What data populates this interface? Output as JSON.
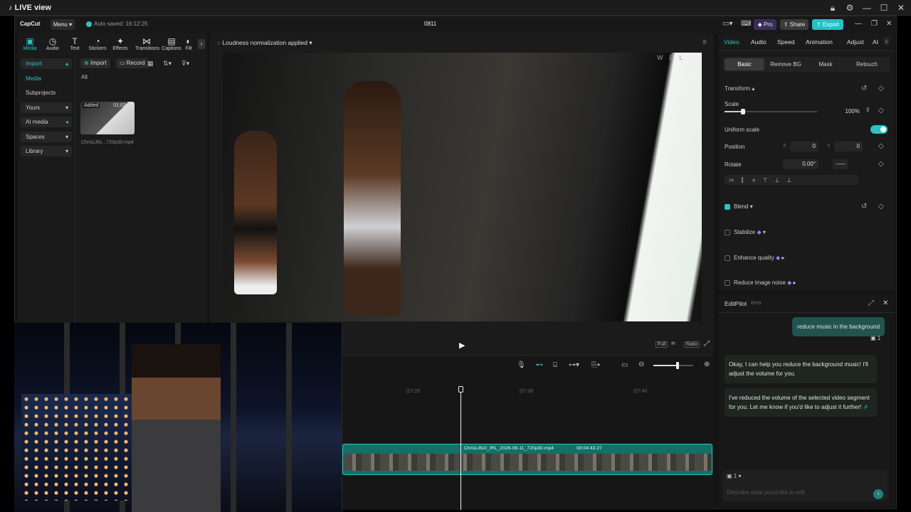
{
  "window": {
    "title": "LIVE view"
  },
  "header": {
    "logo": "CapCut",
    "menu": "Menu",
    "autosave": "Auto saved: 16:12:25",
    "project": "0811",
    "pro": "Pro",
    "share": "Share",
    "export": "Export"
  },
  "toolbar": {
    "tabs": [
      {
        "label": "Media",
        "icon": "▣"
      },
      {
        "label": "Audio",
        "icon": "◷"
      },
      {
        "label": "Text",
        "icon": "T"
      },
      {
        "label": "Stickers",
        "icon": "◔"
      },
      {
        "label": "Effects",
        "icon": "✦"
      },
      {
        "label": "Transitions",
        "icon": "⋈"
      },
      {
        "label": "Captions",
        "icon": "▤"
      },
      {
        "label": "Filt",
        "icon": "◐"
      }
    ]
  },
  "sidebar": {
    "items": [
      "Import",
      "Media",
      "Subprojects",
      "Yours",
      "AI media",
      "Spaces",
      "Library"
    ]
  },
  "media": {
    "import_btn": "Import",
    "record_btn": "Record",
    "filter_all": "All",
    "clip_badge": "Added",
    "clip_duration": "01:02:11",
    "clip_name": "ChrisLifts...720p30.mp4"
  },
  "player": {
    "status": "Loudness normalization applied",
    "full": "Full",
    "ratio": "Ratio",
    "watermark": "W E L"
  },
  "inspector": {
    "tabs": [
      "Video",
      "Audio",
      "Speed",
      "Animation",
      "Adjust",
      "AI"
    ],
    "subtabs": [
      "Basic",
      "Remove BG",
      "Mask",
      "Retouch"
    ],
    "transform": "Transform",
    "scale": "Scale",
    "scale_value": "100%",
    "scale_level": 0.2,
    "uniform_scale": "Uniform scale",
    "position": "Position",
    "pos_x_label": "X",
    "pos_x": "0",
    "pos_y_label": "Y",
    "pos_y": "0",
    "rotate": "Rotate",
    "rotate_value": "0.00°",
    "blend": "Blend",
    "stabilize": "Stabilize",
    "enhance": "Enhance quality",
    "reduce_noise": "Reduce image noise"
  },
  "editpilot": {
    "title": "EditPilot",
    "beta": "Beta",
    "user_msg": "reduce music in the background",
    "clip_count": "1",
    "ai_msg1": "Okay, I can help you reduce the background music! I'll adjust the volume for you.",
    "ai_msg2": "I've reduced the volume of the selected video segment for you. Let me know if you'd like to adjust it further!",
    "attach_count": "1",
    "input_placeholder": "Describe what you'd like to edit"
  },
  "timeline": {
    "ticks": [
      "|27:20",
      "|27:30",
      "|27:40"
    ],
    "clip_name": "ChrisLifts0_IRL_2026-08-11_720p30.mp4",
    "clip_duration": "00:04:43:27",
    "zoom_level": 0.6
  },
  "colors": {
    "accent": "#2bc4c0",
    "bg": "#141414",
    "panel": "#1a1a1a"
  }
}
